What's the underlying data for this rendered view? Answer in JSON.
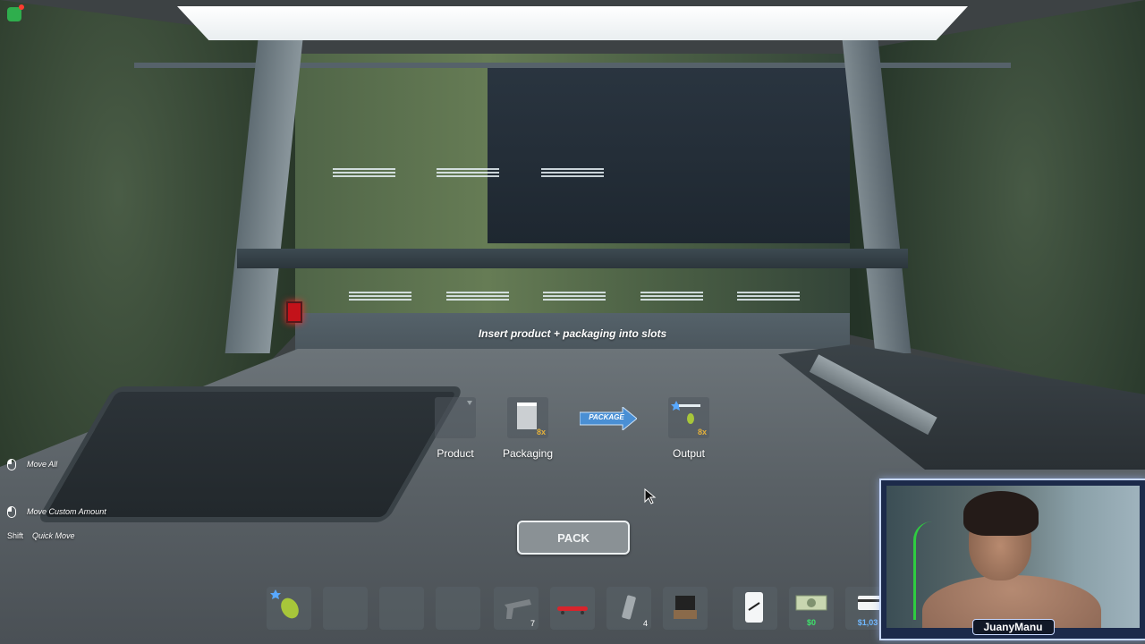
{
  "instruction": "Insert product + packaging into slots",
  "slots": {
    "product": {
      "label": "Product"
    },
    "packaging": {
      "label": "Packaging",
      "count": "8x"
    },
    "output": {
      "label": "Output",
      "count": "8x"
    }
  },
  "package_arrow_label": "PACKAGE",
  "pack_button": "PACK",
  "controls": {
    "move_all": "Move All",
    "move_custom": "Move Custom Amount",
    "quick_move_key": "Shift",
    "quick_move": "Quick Move"
  },
  "hotbar": [
    {
      "item": "product-bag-icon",
      "qty": ""
    },
    {
      "item": "",
      "qty": ""
    },
    {
      "item": "",
      "qty": ""
    },
    {
      "item": "",
      "qty": ""
    },
    {
      "item": "pistol-icon",
      "qty": "7"
    },
    {
      "item": "skateboard-icon",
      "qty": ""
    },
    {
      "item": "packaging-icon",
      "qty": "4"
    },
    {
      "item": "box-icon",
      "qty": ""
    },
    {
      "item": "phone-icon",
      "qty": ""
    },
    {
      "item": "cash-icon",
      "money": "$0"
    },
    {
      "item": "card-icon",
      "money": "$1,03"
    }
  ],
  "webcam": {
    "name": "JuanyManu"
  },
  "colors": {
    "money_green": "#3ee36b",
    "slot_count": "#e5b13a",
    "arrow_blue": "#4a8fd4"
  }
}
